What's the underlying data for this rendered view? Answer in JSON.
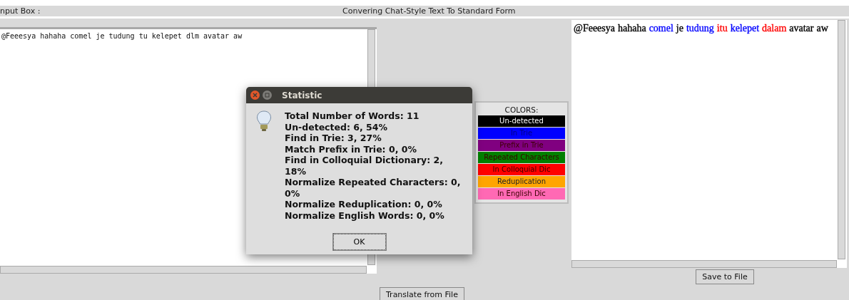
{
  "header": {
    "input_label": "nput Box :",
    "title": "Convering Chat-Style Text To Standard Form"
  },
  "input_box": {
    "value": "@Feeesya hahaha comel je tudung tu kelepet dlm avatar aw"
  },
  "legend": {
    "title": "COLORS:",
    "items": [
      {
        "label": "Un-detected",
        "color": "#000000"
      },
      {
        "label": "In Trie",
        "color": "#0000ff"
      },
      {
        "label": "Prefix in Trie",
        "color": "#800080"
      },
      {
        "label": "Repeated Characters",
        "color": "#008000"
      },
      {
        "label": "In Colloquial Dic",
        "color": "#ff0000"
      },
      {
        "label": "Reduplication",
        "color": "#ffa500"
      },
      {
        "label": "In English Dic",
        "color": "#ff69b4"
      }
    ]
  },
  "output_words": [
    {
      "text": "@Feeesya",
      "color": "#000000"
    },
    {
      "text": "hahaha",
      "color": "#000000"
    },
    {
      "text": "comel",
      "color": "#0000ff"
    },
    {
      "text": "je",
      "color": "#000000"
    },
    {
      "text": "tudung",
      "color": "#0000ff"
    },
    {
      "text": "itu",
      "color": "#ff0000"
    },
    {
      "text": "kelepet",
      "color": "#0000ff"
    },
    {
      "text": "dalam",
      "color": "#ff0000"
    },
    {
      "text": "avatar",
      "color": "#000000"
    },
    {
      "text": "aw",
      "color": "#000000"
    }
  ],
  "save_button": "Save to File",
  "translate_button": "Translate from File",
  "dialog": {
    "title": "Statistic",
    "lines": [
      "Total Number of Words: 11",
      "Un-detected: 6, 54%",
      "Find in Trie: 3, 27%",
      "Match Prefix in Trie: 0, 0%",
      "Find in Colloquial Dictionary: 2, 18%",
      "Normalize Repeated Characters: 0, 0%",
      "Normalize Reduplication: 0, 0%",
      "Normalize English Words: 0, 0%"
    ],
    "ok": "OK"
  }
}
